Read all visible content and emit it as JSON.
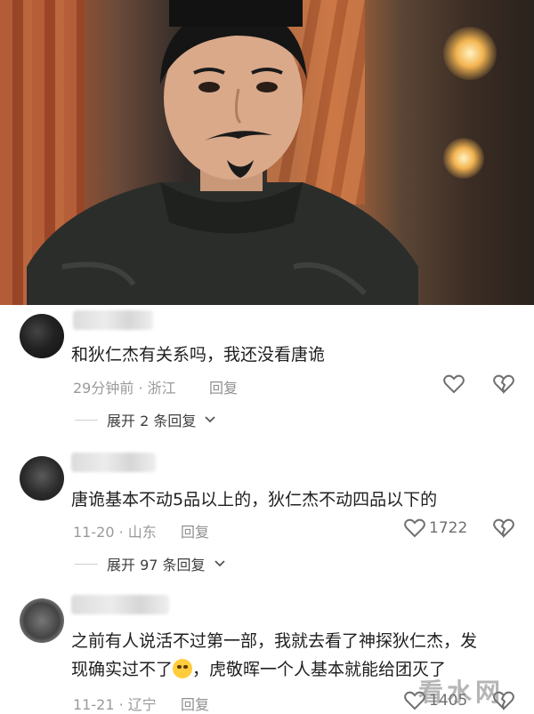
{
  "comments": [
    {
      "text": "和狄仁杰有关系吗，我还没看唐诡",
      "meta": "29分钟前 · 浙江",
      "reply_label": "回复",
      "likes": "",
      "expand_label": "展开 2 条回复"
    },
    {
      "text": "唐诡基本不动5品以上的，狄仁杰不动四品以下的",
      "meta": "11-20 · 山东",
      "reply_label": "回复",
      "likes": "1722",
      "expand_label": "展开 97 条回复"
    },
    {
      "text_line1": "之前有人说活不过第一部，我就去看了神探狄仁杰，发",
      "text_line2_a": "现确实过不了",
      "text_line2_b": "，虎敬晖一个人基本就能给团灭了",
      "meta": "11-21 · 辽宁",
      "reply_label": "回复",
      "likes": "1405"
    }
  ],
  "watermark": "看水网",
  "icons": {
    "like": "heart-outline-icon",
    "dislike": "broken-heart-icon",
    "expand": "chevron-down-icon",
    "emoji": "crying-laughing-emoji"
  },
  "colors": {
    "text": "#1f1f1f",
    "meta": "#9a9a9a",
    "icon": "#6f6f6f"
  }
}
